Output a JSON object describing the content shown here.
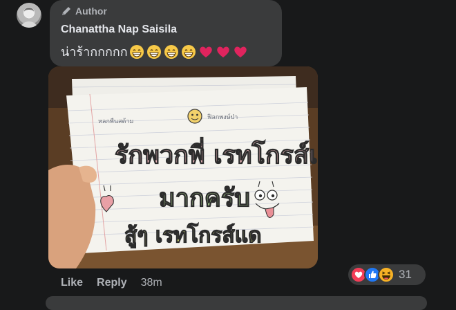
{
  "comment": {
    "author_badge": "Author",
    "name": "Chanattha Nap Saisila",
    "text": "น่าร้ากกกกก",
    "emojis": [
      "grinning-face",
      "grinning-face",
      "grinning-face",
      "grinning-face",
      "red-heart",
      "red-heart",
      "red-heart"
    ]
  },
  "photo": {
    "sign_top_left": "หลกพืนสต้าม",
    "sign_top_right": "ฟิลกพงษ์ป่า",
    "sign_line1": "รักพวกพี่ เรทโกรส์แด",
    "sign_line2": "มากครับ",
    "sign_line3": "สู้ๆ เรทโกรส์แด"
  },
  "actions": {
    "like": "Like",
    "reply": "Reply",
    "time": "38m"
  },
  "reactions": {
    "types": [
      "love",
      "like",
      "haha"
    ],
    "count": "31"
  },
  "colors": {
    "background": "#18191a",
    "bubble": "#3a3b3c",
    "secondary_text": "#b0b3b8",
    "primary_text": "#e4e6eb"
  }
}
